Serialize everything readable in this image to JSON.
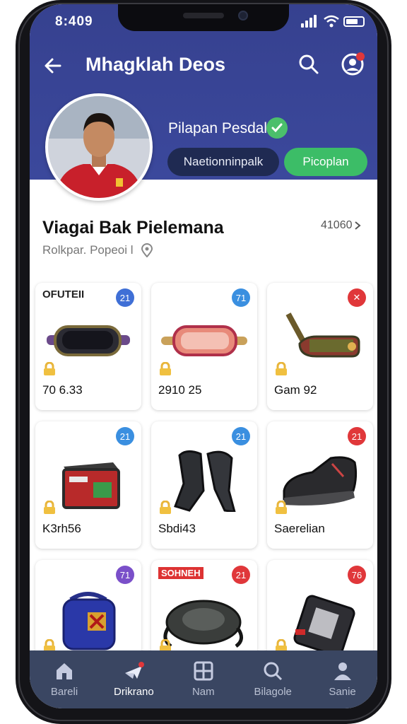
{
  "status_bar": {
    "time": "8:409"
  },
  "header": {
    "title": "Mhagklah Deos",
    "player_name": "Pilapan Pesdal",
    "follow_label": "Naetionninpalk",
    "action_label": "Picoplan"
  },
  "section": {
    "title": "Viagai Bak Pielemana",
    "count": "41060",
    "location": "Rolkpar. Popeoi l"
  },
  "items": [
    {
      "tag": "OFUTEII",
      "badge": "21",
      "badge_color": "#3f6fd6",
      "label": "70 6.33",
      "art": "goggles-dark"
    },
    {
      "tag": "",
      "badge": "71",
      "badge_color": "#3a8fe0",
      "label": "2910 25",
      "art": "goggles-red"
    },
    {
      "tag": "",
      "badge": "✕",
      "badge_color": "#e0373a",
      "label": "Gam 92",
      "art": "strap"
    },
    {
      "tag": "",
      "badge": "21",
      "badge_color": "#3a8fe0",
      "label": "K3rh56",
      "art": "box"
    },
    {
      "tag": "",
      "badge": "21",
      "badge_color": "#3a8fe0",
      "label": "Sbdi43",
      "art": "gloves"
    },
    {
      "tag": "",
      "badge": "21",
      "badge_color": "#e0373a",
      "label": "Saerelian",
      "art": "shoe"
    },
    {
      "tag": "",
      "badge": "71",
      "badge_color": "#7a4fc9",
      "label": "",
      "art": "backpack"
    },
    {
      "tag": "SOHNEH",
      "badge": "21",
      "badge_color": "#e0373a",
      "label": "",
      "art": "helmet"
    },
    {
      "tag": "",
      "badge": "76",
      "badge_color": "#e0373a",
      "label": "",
      "art": "radio"
    }
  ],
  "tabs": [
    {
      "label": "Bareli",
      "icon": "home-icon"
    },
    {
      "label": "Drikrano",
      "icon": "plane-icon",
      "active": true
    },
    {
      "label": "Nam",
      "icon": "grid-icon"
    },
    {
      "label": "Bilagole",
      "icon": "search-icon"
    },
    {
      "label": "Sanie",
      "icon": "person-icon"
    }
  ],
  "colors": {
    "header_bg": "#3b489c",
    "accent_green": "#3cbd67",
    "tabbar_bg": "#3a4662"
  }
}
